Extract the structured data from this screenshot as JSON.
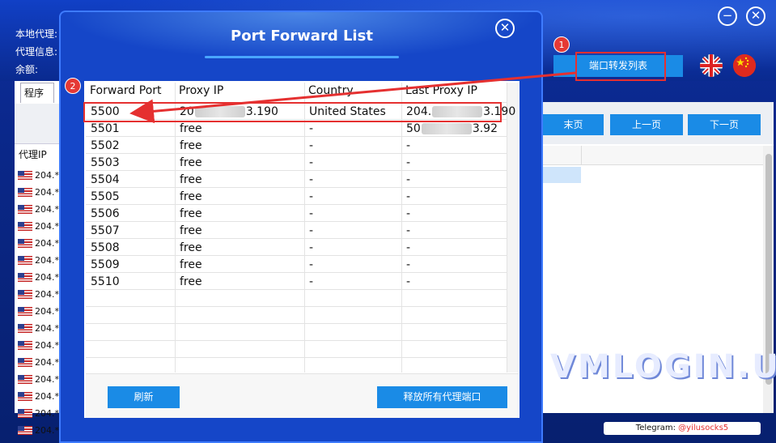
{
  "app": {
    "labels": {
      "local_proxy": "本地代理:",
      "proxy_info": "代理信息:",
      "balance": "余额:"
    },
    "port_forward_button": "端口转发列表",
    "program_tab": "程序",
    "left_column_header": "代理IP",
    "left_rows": [
      "204.*",
      "204.*",
      "204.*",
      "204.*",
      "204.*",
      "204.*",
      "204.*",
      "204.*",
      "204.*",
      "204.*",
      "204.*",
      "204.*",
      "204.*",
      "204.*",
      "204.*",
      "204.*"
    ],
    "pagination": {
      "last": "末页",
      "prev": "上一页",
      "next": "下一页"
    },
    "window_controls": {
      "minimize": "−",
      "close": "✕"
    },
    "telegram": {
      "label": "Telegram: ",
      "handle": "@yilusocks5"
    },
    "watermark": "VMLOGIN.US"
  },
  "annotations": {
    "badge_1": "1",
    "badge_2": "2"
  },
  "dialog": {
    "title": "Port Forward List",
    "close": "✕",
    "columns": [
      "Forward Port",
      "Proxy IP",
      "Country",
      "Last Proxy IP"
    ],
    "rows": [
      {
        "port": "5500",
        "proxy_ip_a": "20",
        "proxy_ip_b": "3.190",
        "country": "United States",
        "last_ip_a": "204.",
        "last_ip_b": "3.190"
      },
      {
        "port": "5501",
        "proxy_ip": "free",
        "country": "-",
        "last_ip_a": "50",
        "last_ip_b": "3.92"
      },
      {
        "port": "5502",
        "proxy_ip": "free",
        "country": "-",
        "last_ip": "-"
      },
      {
        "port": "5503",
        "proxy_ip": "free",
        "country": "-",
        "last_ip": "-"
      },
      {
        "port": "5504",
        "proxy_ip": "free",
        "country": "-",
        "last_ip": "-"
      },
      {
        "port": "5505",
        "proxy_ip": "free",
        "country": "-",
        "last_ip": "-"
      },
      {
        "port": "5506",
        "proxy_ip": "free",
        "country": "-",
        "last_ip": "-"
      },
      {
        "port": "5507",
        "proxy_ip": "free",
        "country": "-",
        "last_ip": "-"
      },
      {
        "port": "5508",
        "proxy_ip": "free",
        "country": "-",
        "last_ip": "-"
      },
      {
        "port": "5509",
        "proxy_ip": "free",
        "country": "-",
        "last_ip": "-"
      },
      {
        "port": "5510",
        "proxy_ip": "free",
        "country": "-",
        "last_ip": "-"
      }
    ],
    "refresh_button": "刷新",
    "release_button": "释放所有代理端口"
  },
  "colors": {
    "accent": "#1a8be6",
    "annotation": "#e53030",
    "dialog_bg": "#1546c8"
  }
}
